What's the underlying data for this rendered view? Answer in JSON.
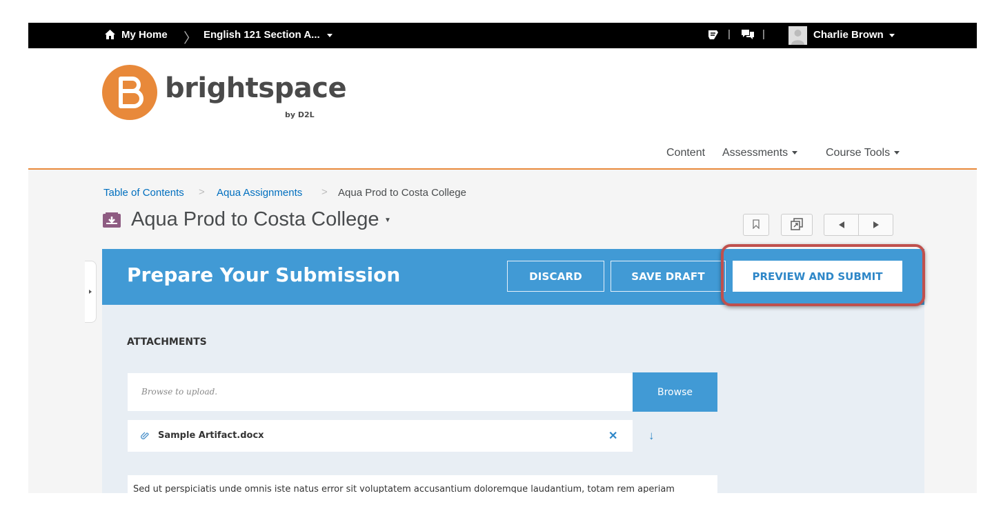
{
  "topbar": {
    "home_label": "My Home",
    "course_label": "English 121 Section A...",
    "user_name": "Charlie Brown",
    "icons": [
      "home-icon",
      "message-alerts-icon",
      "discussion-alerts-icon",
      "user-avatar-icon"
    ]
  },
  "brand": {
    "name": "brightspace",
    "tagline": "by D2L",
    "color": "#e8893a"
  },
  "nav": {
    "content": "Content",
    "assessments": "Assessments",
    "course_tools": "Course Tools"
  },
  "breadcrumb": {
    "item1": "Table of Contents",
    "item2": "Aqua Assignments",
    "current": "Aqua Prod to Costa College"
  },
  "page": {
    "title": "Aqua Prod to Costa College"
  },
  "banner": {
    "title": "Prepare Your Submission",
    "discard": "DISCARD",
    "save_draft": "SAVE DRAFT",
    "preview_submit": "PREVIEW AND SUBMIT",
    "color": "#419ad5"
  },
  "attachments": {
    "heading": "ATTACHMENTS",
    "upload_placeholder": "Browse to upload.",
    "browse_label": "Browse",
    "file_name": "Sample Artifact.docx",
    "remove_glyph": "✕",
    "download_glyph": "↓"
  },
  "body_text": "Sed ut perspiciatis unde omnis iste natus error sit voluptatem accusantium doloremque laudantium, totam rem aperiam"
}
